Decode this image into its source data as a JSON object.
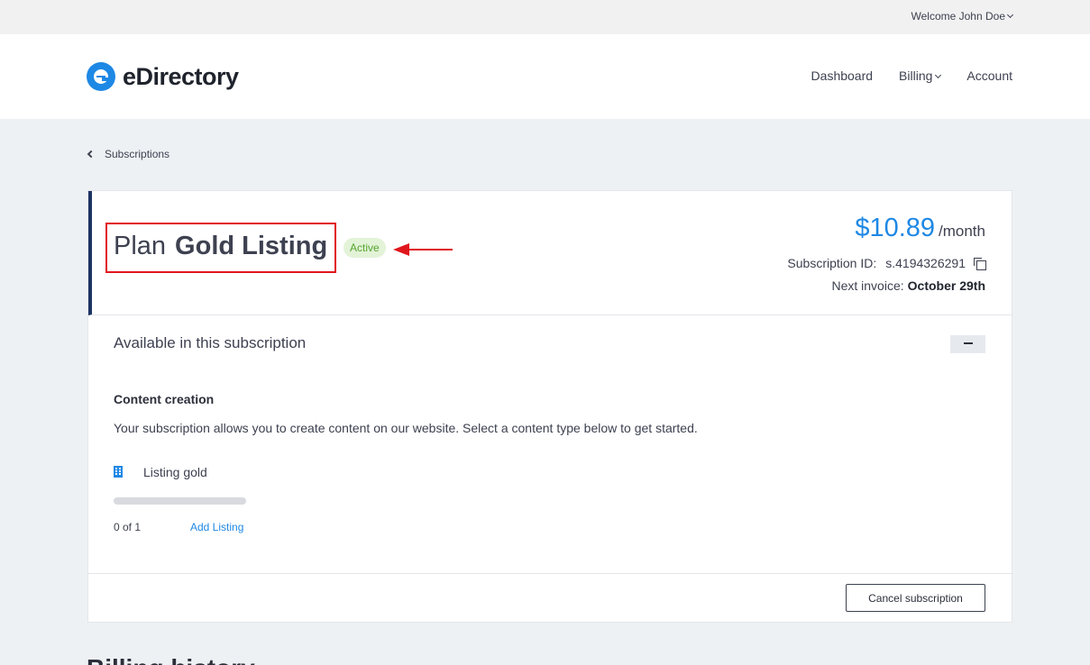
{
  "topbar": {
    "welcome": "Welcome John Doe"
  },
  "header": {
    "logo_text": "eDirectory",
    "nav": [
      {
        "label": "Dashboard"
      },
      {
        "label": "Billing"
      },
      {
        "label": "Account"
      }
    ]
  },
  "breadcrumb": {
    "back_label": "Subscriptions"
  },
  "plan": {
    "prefix": "Plan",
    "name": "Gold Listing",
    "status": "Active",
    "price": "$10.89",
    "period": "/month",
    "subscription_id_label": "Subscription ID:",
    "subscription_id": "s.4194326291",
    "next_invoice_label": "Next invoice:",
    "next_invoice_date": "October 29th"
  },
  "available": {
    "title": "Available in this subscription",
    "section_title": "Content creation",
    "description": "Your subscription allows you to create content on our website. Select a content type below to get started.",
    "items": [
      {
        "label": "Listing gold",
        "count": "0 of 1",
        "used_fraction": 0,
        "action": "Add Listing"
      }
    ]
  },
  "footer": {
    "cancel_label": "Cancel subscription"
  },
  "next_section": {
    "title": "Billing history"
  },
  "colors": {
    "accent": "#1e88e5",
    "highlight": "#e0161d",
    "active_badge": "#54a52e"
  }
}
